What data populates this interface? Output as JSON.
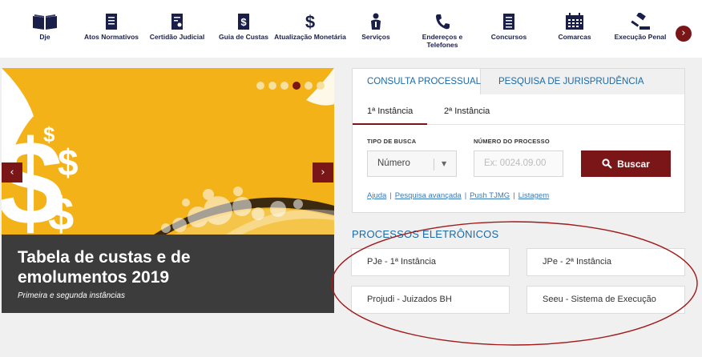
{
  "nav": {
    "items": [
      {
        "label": "Dje",
        "icon": "book-icon"
      },
      {
        "label": "Atos Normativos",
        "icon": "document-icon"
      },
      {
        "label": "Certidão Judicial",
        "icon": "certificate-icon"
      },
      {
        "label": "Guia de Custas",
        "icon": "dollar-document-icon"
      },
      {
        "label": "Atualização Monetária",
        "icon": "dollar-icon"
      },
      {
        "label": "Serviços",
        "icon": "info-person-icon"
      },
      {
        "label": "Endereços e Telefones",
        "icon": "phone-icon"
      },
      {
        "label": "Concursos",
        "icon": "list-document-icon"
      },
      {
        "label": "Comarcas",
        "icon": "calendar-icon"
      },
      {
        "label": "Execução Penal",
        "icon": "gavel-icon"
      }
    ],
    "next_icon": "›"
  },
  "banner": {
    "title": "Tabela de custas e de emolumentos 2019",
    "subtitle": "Primeira e segunda instâncias",
    "prev": "‹",
    "next": "›",
    "slide_count": 6,
    "active_slide": 4
  },
  "consulta": {
    "tabs": [
      "CONSULTA PROCESSUAL",
      "PESQUISA DE JURISPRUDÊNCIA"
    ],
    "subtabs": [
      "1ª Instância",
      "2ª Instância"
    ],
    "tipo_label": "TIPO DE BUSCA",
    "tipo_value": "Número",
    "numero_label": "NÚMERO DO PROCESSO",
    "numero_placeholder": "Ex: 0024.09.00",
    "buscar": "Buscar",
    "links": [
      "Ajuda",
      "Pesquisa avançada",
      "Push TJMG",
      "Listagem"
    ]
  },
  "processos": {
    "title": "PROCESSOS ELETRÔNICOS",
    "buttons": [
      "PJe - 1ª Instância",
      "JPe - 2ª Instância",
      "Projudi - Juizados BH",
      "Seeu - Sistema de Execução"
    ]
  },
  "colors": {
    "brand": "#7a1618",
    "link": "#1b6aa5",
    "navy": "#1a1f4a",
    "banner_yellow": "#f3b218",
    "annotation": "#a01a1a"
  }
}
